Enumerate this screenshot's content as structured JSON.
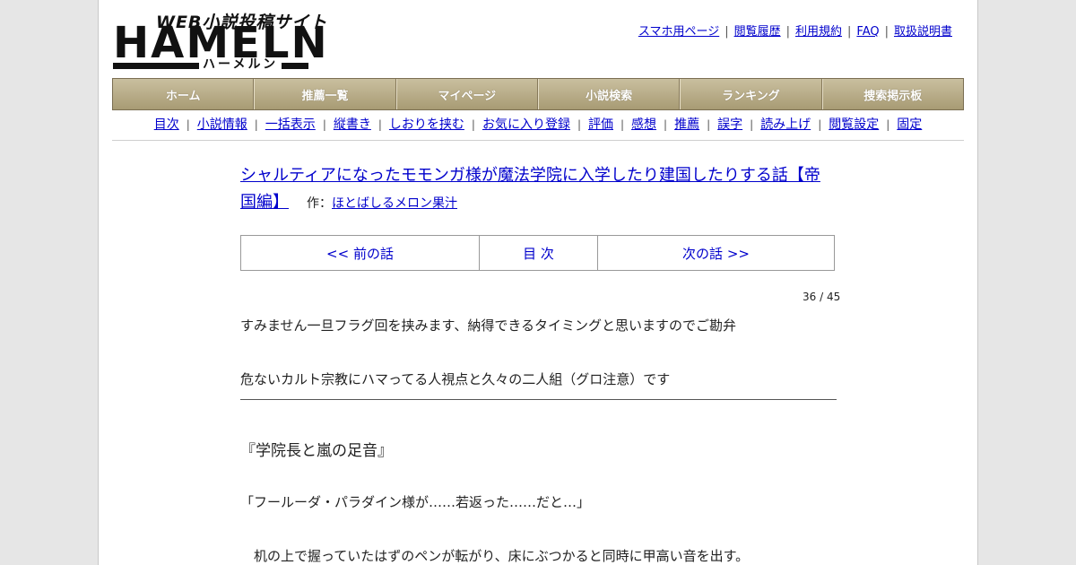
{
  "logo": {
    "subtitle": "WEB小説投稿サイト",
    "main": "HAMELN",
    "kana": "ハーメルン"
  },
  "top_links": [
    "スマホ用ページ",
    "閲覧履歴",
    "利用規約",
    "FAQ",
    "取扱説明書"
  ],
  "nav": [
    "ホーム",
    "推薦一覧",
    "マイページ",
    "小説検索",
    "ランキング",
    "捜索掲示板"
  ],
  "submenu": [
    "目次",
    "小説情報",
    "一括表示",
    "縦書き",
    "しおりを挟む",
    "お気に入り登録",
    "評価",
    "感想",
    "推薦",
    "誤字",
    "読み上げ",
    "閲覧設定",
    "固定"
  ],
  "novel": {
    "title": "シャルティアになったモモンガ様が魔法学院に入学したり建国したりする話【帝国編】",
    "author_label": "作：",
    "author": "ほとばしるメロン果汁"
  },
  "pager": {
    "prev": "<< 前の話",
    "toc": "目 次",
    "next": "次の話 >>"
  },
  "episode_count": "36 / 45",
  "preface": [
    "すみません一旦フラグ回を挟みます、納得できるタイミングと思いますのでご勘弁",
    "危ないカルト宗教にハマってる人視点と久々の二人組（グロ注意）です"
  ],
  "chapter_title": "『学院長と嵐の足音』",
  "body": [
    "「フールーダ・パラダイン様が……若返った……だと…」",
    "　机の上で握っていたはずのペンが転がり、床にぶつかると同時に甲高い音を出す。"
  ]
}
